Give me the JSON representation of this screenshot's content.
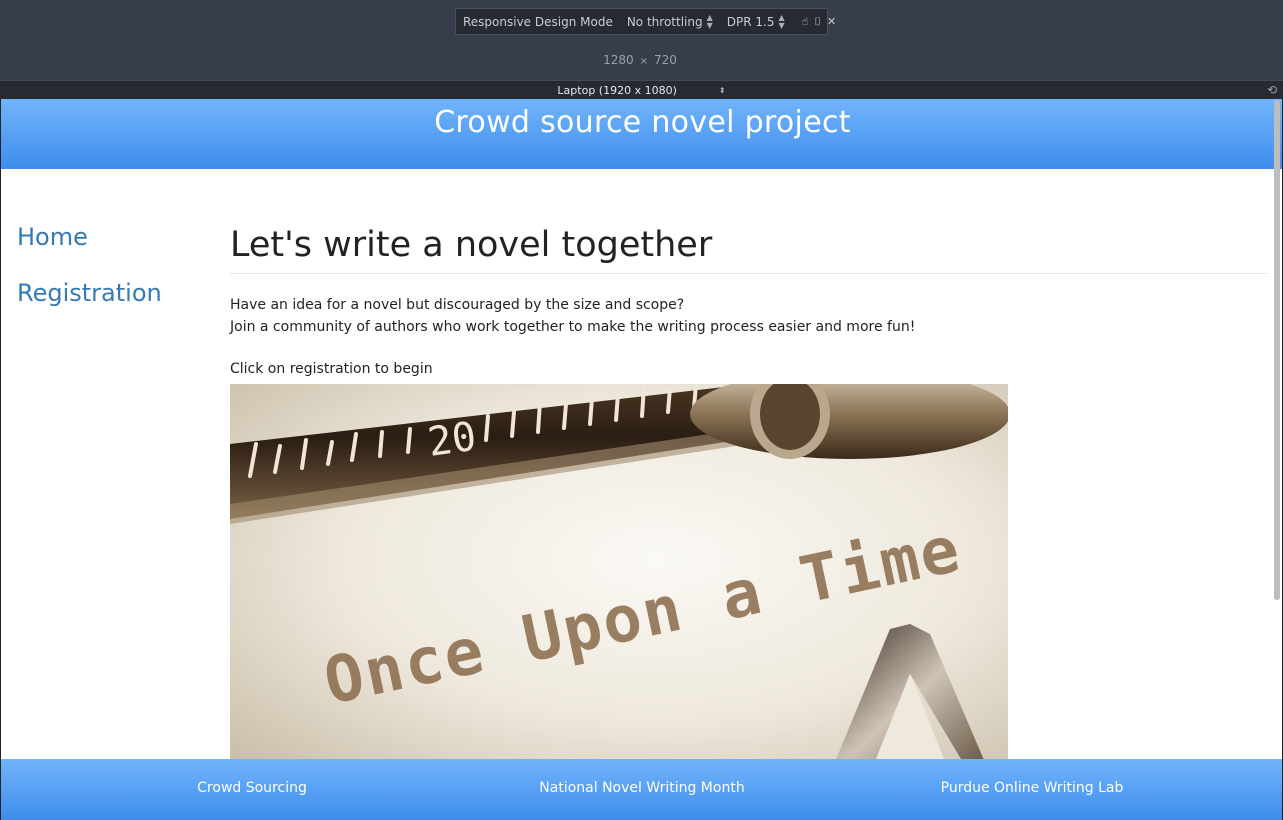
{
  "devtools": {
    "mode_label": "Responsive Design Mode",
    "throttling": "No throttling",
    "dpr_label": "DPR",
    "dpr_value": "1.5",
    "viewport_width": "1280",
    "viewport_height": "720",
    "size_separator": "×",
    "device": "Laptop (1920 x 1080)"
  },
  "site": {
    "title": "Crowd source novel project",
    "nav": [
      {
        "label": "Home"
      },
      {
        "label": "Registration"
      }
    ],
    "headline": "Let's write a novel together",
    "intro_line1": "Have an idea for a novel but discouraged by the size and scope?",
    "intro_line2": "Join a community of authors who work together to make the writing process easier and more fun!",
    "cta": "Click on registration to begin",
    "hero_image": {
      "scale_number": "20",
      "typed_line1": "Once Upon a Time"
    },
    "footer_links": [
      {
        "label": "Crowd Sourcing"
      },
      {
        "label": "National Novel Writing Month"
      },
      {
        "label": "Purdue Online Writing Lab"
      }
    ]
  }
}
